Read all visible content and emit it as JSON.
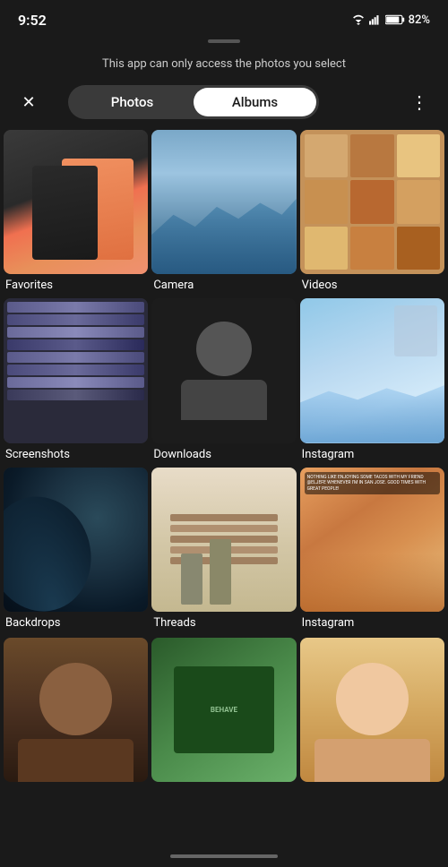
{
  "statusBar": {
    "time": "9:52",
    "battery": "82%"
  },
  "banner": {
    "text": "This app can only access the photos you select"
  },
  "nav": {
    "tabs": [
      {
        "id": "photos",
        "label": "Photos",
        "active": false
      },
      {
        "id": "albums",
        "label": "Albums",
        "active": true
      }
    ],
    "moreIcon": "⋮"
  },
  "albums": [
    {
      "id": "favorites",
      "label": "Favorites",
      "thumbType": "favorites"
    },
    {
      "id": "camera",
      "label": "Camera",
      "thumbType": "camera"
    },
    {
      "id": "videos",
      "label": "Videos",
      "thumbType": "videos"
    },
    {
      "id": "screenshots",
      "label": "Screenshots",
      "thumbType": "screenshots"
    },
    {
      "id": "downloads",
      "label": "Downloads",
      "thumbType": "downloads"
    },
    {
      "id": "instagram1",
      "label": "Instagram",
      "thumbType": "instagram"
    },
    {
      "id": "backdrops",
      "label": "Backdrops",
      "thumbType": "backdrops"
    },
    {
      "id": "threads",
      "label": "Threads",
      "thumbType": "threads"
    },
    {
      "id": "instagram2",
      "label": "Instagram",
      "thumbType": "instagram2"
    }
  ],
  "bottomRow": [
    {
      "id": "person1",
      "thumbType": "person1"
    },
    {
      "id": "green",
      "thumbType": "green"
    },
    {
      "id": "person2",
      "thumbType": "person2"
    }
  ]
}
